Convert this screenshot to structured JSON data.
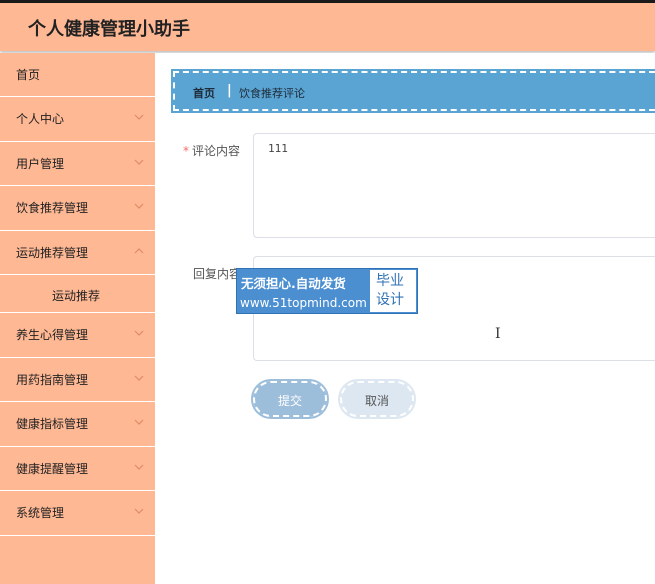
{
  "header": {
    "title": "个人健康管理小助手"
  },
  "sidebar": {
    "items": [
      {
        "label": "首页",
        "has_arrow": false
      },
      {
        "label": "个人中心",
        "has_arrow": true
      },
      {
        "label": "用户管理",
        "has_arrow": true
      },
      {
        "label": "饮食推荐管理",
        "has_arrow": true
      },
      {
        "label": "运动推荐管理",
        "has_arrow": true
      },
      {
        "label": "运动推荐",
        "has_arrow": false,
        "sub": true
      },
      {
        "label": "养生心得管理",
        "has_arrow": true
      },
      {
        "label": "用药指南管理",
        "has_arrow": true
      },
      {
        "label": "健康指标管理",
        "has_arrow": true
      },
      {
        "label": "健康提醒管理",
        "has_arrow": true
      },
      {
        "label": "系统管理",
        "has_arrow": true
      }
    ]
  },
  "breadcrumb": {
    "home": "首页",
    "separator": "|",
    "current": "饮食推荐评论"
  },
  "form": {
    "comment": {
      "label": "评论内容",
      "required_mark": "*",
      "value": "111"
    },
    "reply": {
      "label": "回复内容",
      "value": ""
    }
  },
  "buttons": {
    "submit": "提交",
    "cancel": "取消"
  },
  "watermark": {
    "line1": "无须担心.自动发货",
    "line2": "www.51topmind.com",
    "badge": "毕业设计"
  },
  "colors": {
    "header_bg": "#ffb894",
    "sidebar_bg": "#ffb894",
    "breadcrumb_bg": "#5aa4d3",
    "submit_bg": "#9dbedb",
    "cancel_bg": "#dde7f1"
  }
}
